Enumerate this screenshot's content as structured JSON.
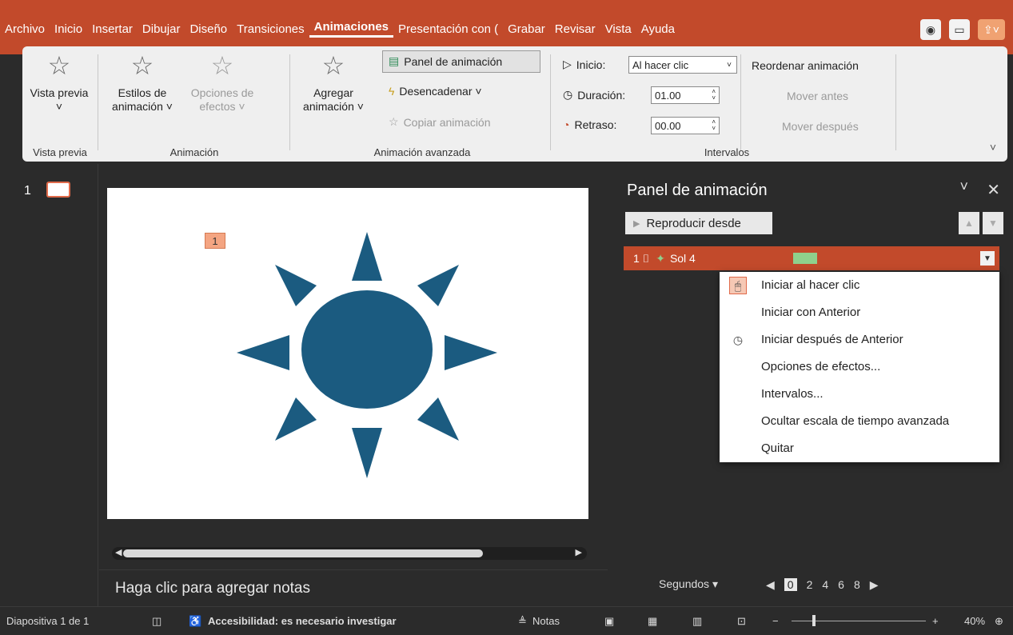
{
  "tabs": [
    "Archivo",
    "Inicio",
    "Insertar",
    "Dibujar",
    "Diseño",
    "Transiciones",
    "Animaciones",
    "Presentación con (",
    "Grabar",
    "Revisar",
    "Vista",
    "Ayuda"
  ],
  "active_tab": "Animaciones",
  "ribbon": {
    "preview": {
      "label": "Vista previa ˅",
      "group": "Vista previa"
    },
    "styles": {
      "label": "Estilos de animación ˅"
    },
    "options": {
      "label": "Opciones de efectos ˅"
    },
    "anim_group": "Animación",
    "add": {
      "label": "Agregar animación ˅"
    },
    "panel_btn": "Panel de animación",
    "trigger": "Desencadenar ˅",
    "copy": "Copiar animación",
    "adv_group": "Animación avanzada",
    "start_label": "Inicio:",
    "start_value": "Al hacer clic",
    "duration_label": "Duración:",
    "duration_value": "01.00",
    "delay_label": "Retraso:",
    "delay_value": "00.00",
    "reorder": "Reordenar animación",
    "move_before": "Mover antes",
    "move_after": "Mover después",
    "timing_group": "Intervalos"
  },
  "slide_pane": {
    "number": "1"
  },
  "slide": {
    "anim_tag": "1"
  },
  "notes": {
    "placeholder": "Haga clic para agregar notas"
  },
  "anim_panel": {
    "title": "Panel de animación",
    "play_label": "Reproducir desde",
    "item": {
      "number": "1",
      "name": "Sol 4"
    }
  },
  "context_menu": [
    {
      "label": "Iniciar al hacer clic",
      "icon": "mouse-click-icon"
    },
    {
      "label": "Iniciar con Anterior",
      "icon": ""
    },
    {
      "label": "Iniciar después de Anterior",
      "icon": "clock-icon"
    },
    {
      "label": "Opciones de efectos...",
      "icon": ""
    },
    {
      "label": "Intervalos...",
      "icon": ""
    },
    {
      "label": "Ocultar escala de tiempo avanzada",
      "icon": ""
    },
    {
      "label": "Quitar",
      "icon": ""
    }
  ],
  "timeline": {
    "label": "Segundos ▾",
    "ticks": [
      "0",
      "2",
      "4",
      "6",
      "8"
    ]
  },
  "status": {
    "slide": "Diapositiva 1 de 1",
    "accessibility": "Accesibilidad: es necesario investigar",
    "notes": "Notas",
    "zoom": "40%"
  },
  "colors": {
    "accent": "#c24a2b",
    "sun": "#1b5b80"
  }
}
